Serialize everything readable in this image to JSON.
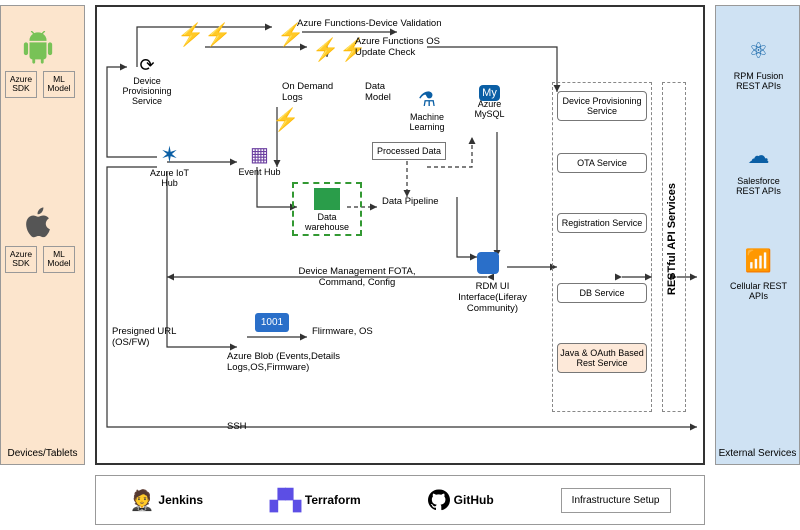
{
  "left": {
    "label": "Devices/Tablets",
    "android": {
      "sdk": "Azure SDK",
      "ml": "ML Model",
      "icon": "android"
    },
    "apple": {
      "sdk": "Azure SDK",
      "ml": "ML Model",
      "icon": "apple"
    }
  },
  "center": {
    "top_fn1": "Azure Functions-Device Validation",
    "top_fn2": "Azure Functions OS Update Check",
    "dev_prov": "Device Provisioning Service",
    "iot_hub": "Azure IoT Hub",
    "event_hub": "Event Hub",
    "on_demand": "On Demand Logs",
    "data_model": "Data Model",
    "ml": "Machine Learning",
    "mysql": "Azure MySQL",
    "processed": "Processed Data",
    "pipeline": "Data Pipeline",
    "warehouse": "Data warehouse",
    "blob": "Azure Blob (Events,Details Logs,OS,Firmware)",
    "firmware": "Flirmware, OS",
    "dev_mgmt": "Device Management FOTA, Command, Config",
    "rdm": "RDM UI Interface(Liferay Community)",
    "presigned": "Presigned URL (OS/FW)",
    "ssh": "SSH",
    "restful": "RESTful API Services",
    "services": [
      {
        "label": "Device Provisioning Service"
      },
      {
        "label": "OTA Service"
      },
      {
        "label": "Registration Service"
      },
      {
        "label": "DB Service"
      },
      {
        "label": "Java & OAuth Based Rest Service"
      }
    ]
  },
  "right": {
    "label": "External Services",
    "items": [
      {
        "label": "RPM Fusion REST APIs"
      },
      {
        "label": "Salesforce REST APIs"
      },
      {
        "label": "Cellular REST APIs"
      }
    ]
  },
  "bottom": {
    "jenkins": "Jenkins",
    "terraform": "Terraform",
    "github": "GitHub",
    "infra": "Infrastructure Setup"
  }
}
